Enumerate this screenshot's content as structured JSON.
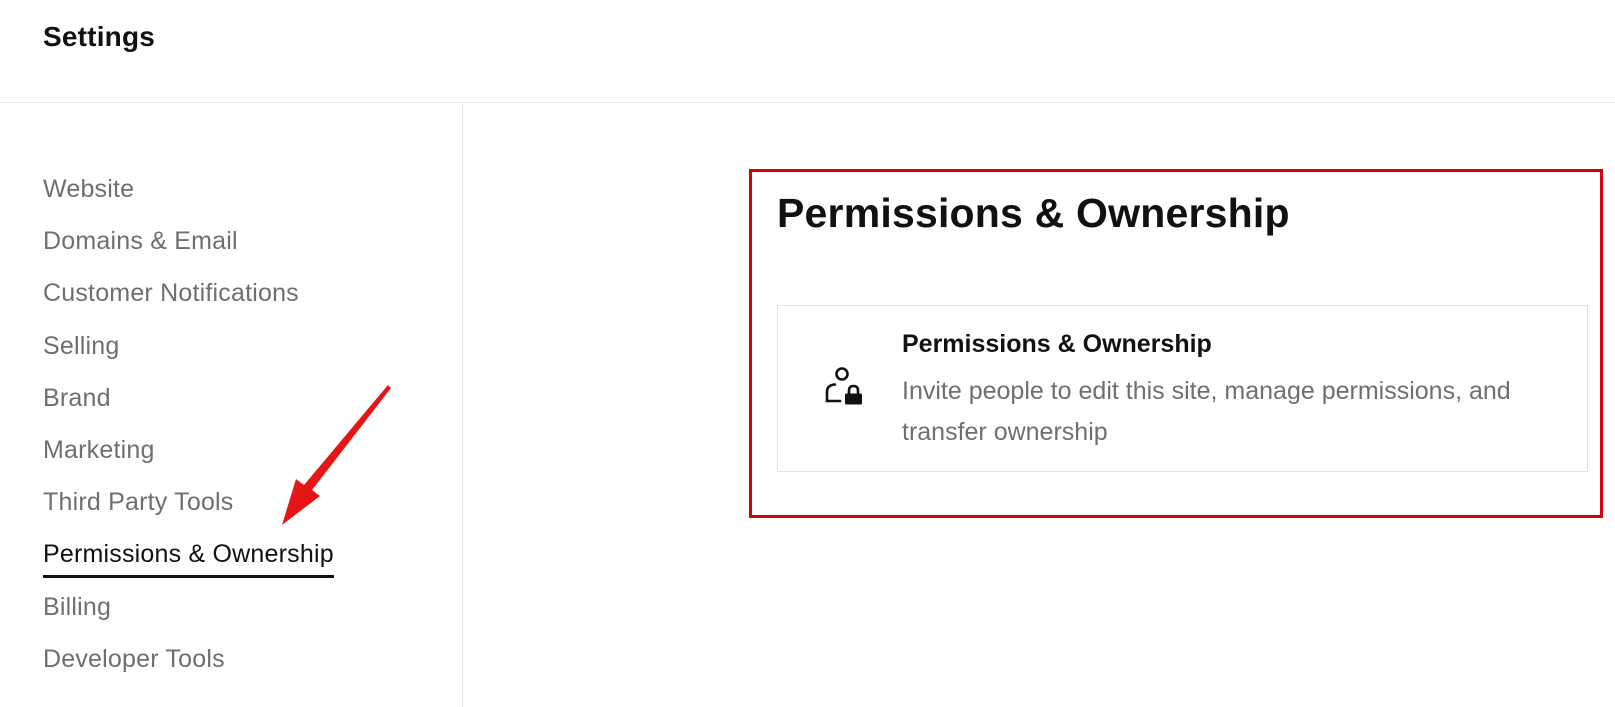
{
  "header": {
    "title": "Settings"
  },
  "sidebar": {
    "items": [
      {
        "label": "Website"
      },
      {
        "label": "Domains & Email"
      },
      {
        "label": "Customer Notifications"
      },
      {
        "label": "Selling"
      },
      {
        "label": "Brand"
      },
      {
        "label": "Marketing"
      },
      {
        "label": "Third Party Tools"
      },
      {
        "label": "Permissions & Ownership",
        "active": true
      },
      {
        "label": "Billing"
      },
      {
        "label": "Developer Tools"
      }
    ]
  },
  "main": {
    "title": "Permissions & Ownership",
    "card": {
      "icon": "user-lock-icon",
      "title": "Permissions & Ownership",
      "description": "Invite people to edit this site, manage permissions, and transfer ownership"
    }
  },
  "annotation": {
    "highlight_color": "#d8000f",
    "arrow_color": "#e8000f"
  }
}
